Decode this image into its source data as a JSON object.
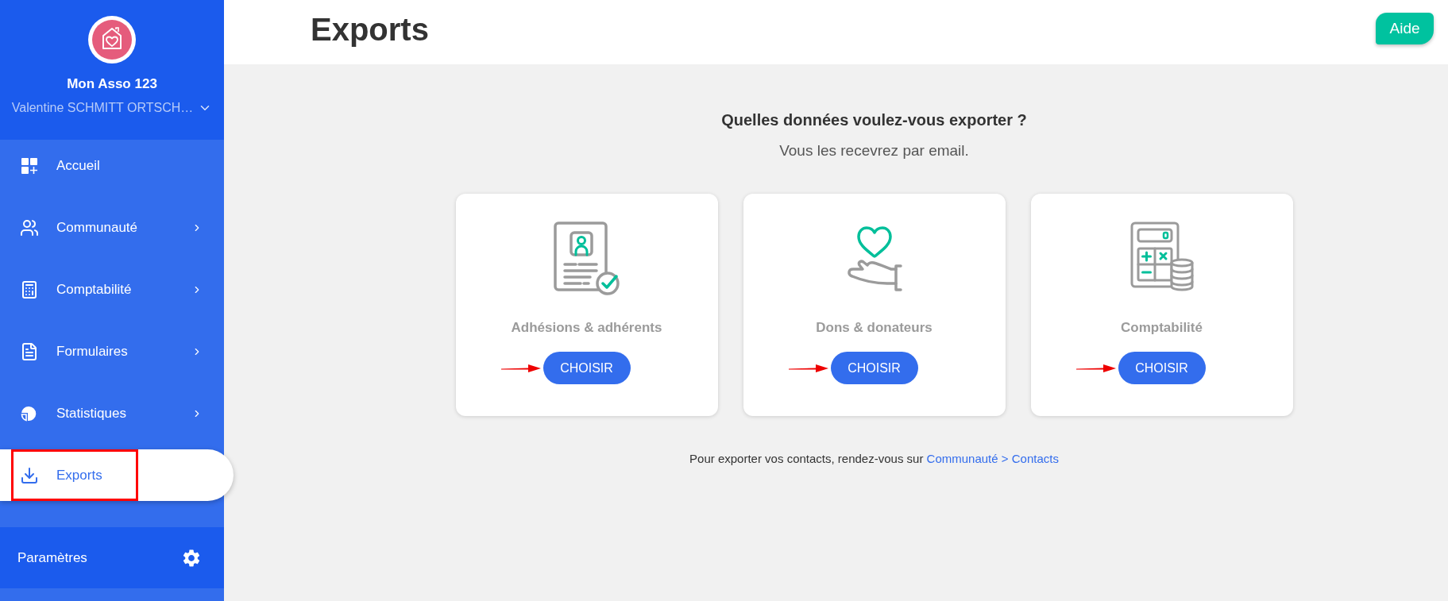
{
  "sidebar": {
    "org_name": "Mon Asso 123",
    "user_name": "Valentine SCHMITT ORTSCH…",
    "items": [
      {
        "label": "Accueil",
        "selected": false,
        "expandable": false,
        "highlighted": false
      },
      {
        "label": "Communauté",
        "selected": false,
        "expandable": true,
        "highlighted": false
      },
      {
        "label": "Comptabilité",
        "selected": false,
        "expandable": true,
        "highlighted": false
      },
      {
        "label": "Formulaires",
        "selected": false,
        "expandable": true,
        "highlighted": false
      },
      {
        "label": "Statistiques",
        "selected": false,
        "expandable": true,
        "highlighted": false
      },
      {
        "label": "Exports",
        "selected": true,
        "expandable": false,
        "highlighted": true
      }
    ],
    "settings": {
      "label": "Paramètres"
    }
  },
  "header": {
    "title": "Exports",
    "help_button": "Aide"
  },
  "content": {
    "heading": "Quelles données voulez-vous exporter ?",
    "subheading": "Vous les recevrez par email.",
    "cards": [
      {
        "title": "Adhésions & adhérents",
        "button": "CHOISIR",
        "pointed_at": true
      },
      {
        "title": "Dons & donateurs",
        "button": "CHOISIR",
        "pointed_at": true
      },
      {
        "title": "Comptabilité",
        "button": "CHOISIR",
        "pointed_at": true
      }
    ],
    "note": {
      "text": "Pour exporter vos contacts, rendez-vous sur",
      "link": "Communauté > Contacts"
    }
  }
}
